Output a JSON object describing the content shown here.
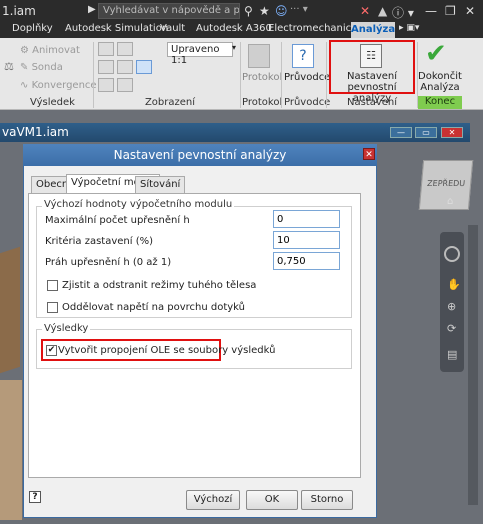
{
  "window": {
    "title": "1.iam",
    "search_placeholder": "Vyhledávat v nápovědě a příkaze"
  },
  "tabs": [
    "Doplňky",
    "Autodesk Simulation",
    "Vault",
    "Autodesk A360",
    "Electromechanical",
    "Analýza"
  ],
  "ribbon": {
    "small_items": [
      "Animovat",
      "Sonda",
      "Konvergence"
    ],
    "dropdown_value": "Upraveno 1:1",
    "panels": {
      "vysledek": "Výsledek",
      "zobrazeni": "Zobrazení",
      "protokol": "Protokol",
      "pruvodce": "Průvodce",
      "nastaveni": "Nastavení",
      "konec": "Konec"
    },
    "buttons": {
      "protokol": "Protokol",
      "pruvodce": "Průvodce",
      "nastaveni": "Nastavení pevnostní analýzy",
      "dokoncit": "Dokončit Analýza"
    }
  },
  "document": {
    "name": "vaVM1.iam"
  },
  "viewcube": {
    "label": "ZEPŘEDU"
  },
  "dialog": {
    "title": "Nastavení pevnostní analýzy",
    "tabs": [
      "Obecné",
      "Výpočetní modul",
      "Sítování"
    ],
    "group1_title": "Výchozí hodnoty výpočetního modulu",
    "fields": [
      {
        "label": "Maximální počet upřesnění h",
        "value": "0"
      },
      {
        "label": "Kritéria zastavení (%)",
        "value": "10"
      },
      {
        "label": "Práh upřesnění h (0 až 1)",
        "value": "0,750"
      }
    ],
    "checkboxes": [
      {
        "label": "Zjistit a odstranit režimy tuhého tělesa",
        "checked": false
      },
      {
        "label": "Oddělovat napětí na povrchu dotyků",
        "checked": false
      }
    ],
    "group2_title": "Výsledky",
    "ole": {
      "label": "Vytvořit propojení OLE se soubory výsledků",
      "checked": true
    },
    "help": "?",
    "buttons": {
      "defaults": "Výchozí",
      "ok": "OK",
      "cancel": "Storno"
    }
  },
  "colors": {
    "accent": "#3c6ea8",
    "highlight": "#e01010",
    "finish_green": "#3aa83a"
  }
}
